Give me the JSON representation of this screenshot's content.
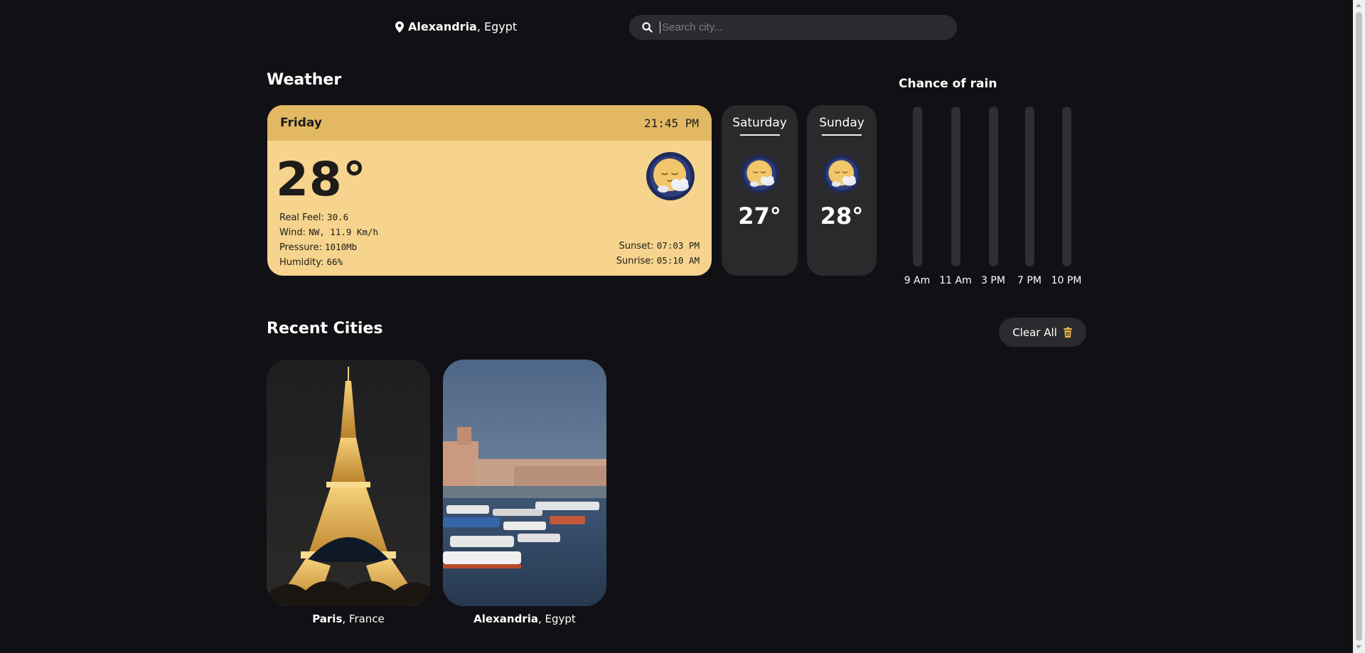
{
  "header": {
    "location_city": "Alexandria",
    "location_country": ", Egypt",
    "search_placeholder": "Search city..."
  },
  "weather": {
    "section_title": "Weather",
    "today": {
      "day": "Friday",
      "time": "21:45 PM",
      "temperature": "28°",
      "real_feel_label": "Real Feel: ",
      "real_feel_value": "30.6",
      "wind_label": "Wind: ",
      "wind_value": "NW, 11.9 Km/h",
      "pressure_label": "Pressure: ",
      "pressure_value": "1010Mb",
      "humidity_label": "Humidity: ",
      "humidity_value": "66%",
      "sunset_label": "Sunset: ",
      "sunset_value": "07:03 PM",
      "sunrise_label": "Sunrise: ",
      "sunrise_value": "05:10 AM",
      "icon": "night-moon-cloud-icon"
    },
    "forecast": [
      {
        "day": "Saturday",
        "temperature": "27°",
        "icon": "night-moon-cloud-icon"
      },
      {
        "day": "Sunday",
        "temperature": "28°",
        "icon": "night-moon-cloud-icon"
      }
    ]
  },
  "chance_of_rain": {
    "title": "Chance of rain",
    "hours": [
      {
        "label": "9 Am",
        "value": 0
      },
      {
        "label": "11 Am",
        "value": 0
      },
      {
        "label": "3 PM",
        "value": 0
      },
      {
        "label": "7 PM",
        "value": 0
      },
      {
        "label": "10 PM",
        "value": 0
      }
    ]
  },
  "recent": {
    "section_title": "Recent Cities",
    "clear_label": "Clear All",
    "cities": [
      {
        "city": "Paris",
        "country": ", France"
      },
      {
        "city": "Alexandria",
        "country": ", Egypt"
      }
    ]
  },
  "colors": {
    "background": "#111014",
    "accent_light": "#f6d48d",
    "accent_dark": "#e2b862",
    "card_dark": "#2a2a2d"
  }
}
